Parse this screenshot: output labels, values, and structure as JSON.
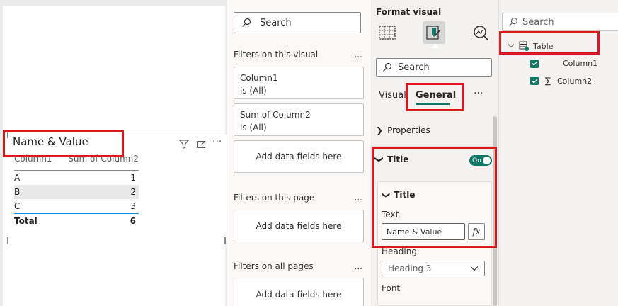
{
  "visual": {
    "title": "Name & Value",
    "table": {
      "columns": [
        "Column1",
        "Sum of Column2"
      ],
      "rows": [
        {
          "label": "A",
          "value": "1"
        },
        {
          "label": "B",
          "value": "2"
        },
        {
          "label": "C",
          "value": "3"
        }
      ],
      "total": {
        "label": "Total",
        "value": "6"
      }
    }
  },
  "filters": {
    "search_placeholder": "Search",
    "on_visual": "Filters on this visual",
    "card1_name": "Column1",
    "card1_state": "is (All)",
    "card2_name": "Sum of Column2",
    "card2_state": "is (All)",
    "add_fields": "Add data fields here",
    "on_page": "Filters on this page",
    "on_all_pages": "Filters on all pages",
    "more": "..."
  },
  "format": {
    "title": "Format visual",
    "search_placeholder": "Search",
    "tab_visual": "Visual",
    "tab_general": "General",
    "more": "···",
    "properties": "Properties",
    "title_section": "Title",
    "toggle_label": "On",
    "title_subsection": "Title",
    "text_label": "Text",
    "text_value": "Name & Value",
    "fx_label": "fx",
    "heading_label": "Heading",
    "heading_value": "Heading 3",
    "font_label": "Font"
  },
  "data_pane": {
    "search_placeholder": "Search",
    "table_name": "Table",
    "fields": [
      "Column1",
      "Column2"
    ]
  },
  "colors": {
    "highlight": "#e0161e",
    "accent": "#117865",
    "total_rule": "#118dff"
  }
}
